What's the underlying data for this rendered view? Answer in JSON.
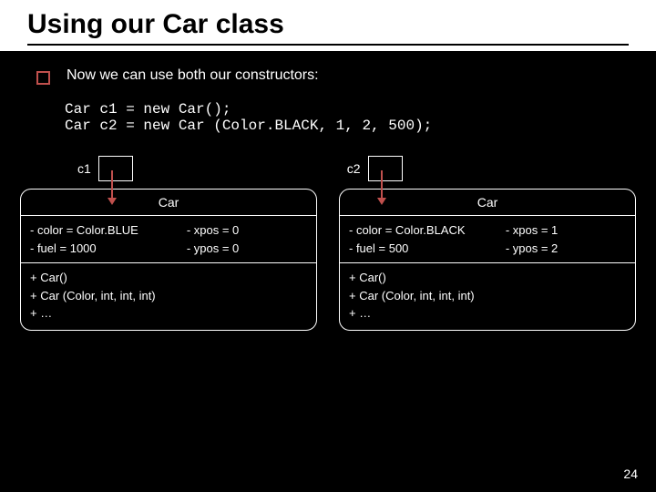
{
  "title": "Using our Car class",
  "bullet_text": "Now we can use both our constructors:",
  "code": "Car c1 = new Car();\nCar c2 = new Car (Color.BLACK, 1, 2, 500);",
  "vars": {
    "c1": "c1",
    "c2": "c2"
  },
  "objects": {
    "left": {
      "class_name": "Car",
      "attr1": "- color = Color.BLUE",
      "attr2": "- fuel = 1000",
      "attr3": "- xpos = 0",
      "attr4": "- ypos = 0",
      "m1": "+ Car()",
      "m2": "+ Car (Color, int, int, int)",
      "m3": "+ …"
    },
    "right": {
      "class_name": "Car",
      "attr1": "- color = Color.BLACK",
      "attr2": "- fuel = 500",
      "attr3": "- xpos = 1",
      "attr4": "- ypos = 2",
      "m1": "+ Car()",
      "m2": "+ Car (Color, int, int, int)",
      "m3": "+ …"
    }
  },
  "page_number": "24"
}
